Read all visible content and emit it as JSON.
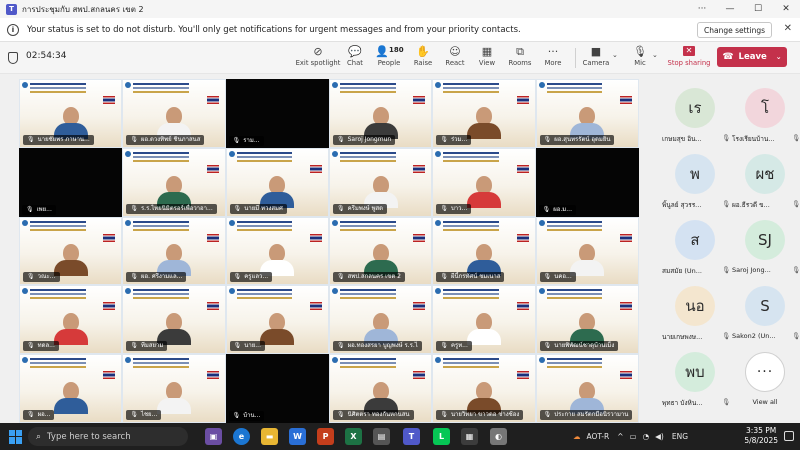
{
  "window": {
    "title": "การประชุมกับ สพป.สกลนคร เขต 2"
  },
  "banner": {
    "message": "Your status is set to do not disturb. You'll only get notifications for urgent messages and from your priority contacts.",
    "change_settings_label": "Change settings"
  },
  "toolbar": {
    "timer": "02:54:34",
    "exit_spotlight": "Exit spotlight",
    "chat": "Chat",
    "people": "People",
    "people_count": "180",
    "raise": "Raise",
    "react": "React",
    "view": "View",
    "rooms": "Rooms",
    "more": "More",
    "camera": "Camera",
    "mic": "Mic",
    "stop_sharing": "Stop sharing",
    "leave": "Leave"
  },
  "tiles": [
    {
      "name": "นายชัยพร ภาษาน..."
    },
    {
      "name": "ผอ.ดวงทิพย์ ชินภาสนส"
    },
    {
      "name": "ราม..."
    },
    {
      "name": "Saroj Jongmun"
    },
    {
      "name": "ร่วม..."
    },
    {
      "name": "ผอ.สุนทรรัตน์ อุดมยิน"
    },
    {
      "name": "เพย..."
    },
    {
      "name": "ร.ร.ไทยนิมิตรอร์เพื่อวาอา..."
    },
    {
      "name": "นายมี ทวงสมศ"
    },
    {
      "name": "ครีมพงษ์ พูสด"
    },
    {
      "name": "บาว..."
    },
    {
      "name": "ผอ.ม..."
    },
    {
      "name": "วณะ..."
    },
    {
      "name": "ผอ. ศรีงามแล..."
    },
    {
      "name": "ครูแลว..."
    },
    {
      "name": "สพป.สกลนคร เขต 2"
    },
    {
      "name": "ผีนี้กรทัศน์ ชมเนาส"
    },
    {
      "name": "นคอ..."
    },
    {
      "name": "ทดล..."
    },
    {
      "name": "ทีมสยาม"
    },
    {
      "name": "นาย..."
    },
    {
      "name": "ผอ.ทองสรยา บูญพงษ์ ร.ร.ไ"
    },
    {
      "name": "ครูท..."
    },
    {
      "name": "นายพิพัฒน์ชาดุบ้านเม็ง"
    },
    {
      "name": "ผอ..."
    },
    {
      "name": "ไชย..."
    },
    {
      "name": "บ้าน..."
    },
    {
      "name": "นิศิตตรา ทองกันหกนสน"
    },
    {
      "name": "นายวิทยา ขาวดอ ช่างช้อง"
    },
    {
      "name": "ประกาย สมรัตกมือนิรวามาน"
    },
    {
      "name": "ไพศ..."
    }
  ],
  "gallery": [
    {
      "initials": "เร",
      "name": "เกษมสุข อิน...",
      "color": "#d9e7d6"
    },
    {
      "initials": "โ",
      "name": "โรงเรียนบ้าน...",
      "color": "#f2d6dc"
    },
    {
      "initials": "พ",
      "name": "พิ้นูลย์ สุวรร...",
      "color": "#d6e4f0"
    },
    {
      "initials": "ผช",
      "name": "ผอ.ธีรวดี ข...",
      "color": "#d5e9e6"
    },
    {
      "initials": "ส",
      "name": "สมสมัย (Un...",
      "color": "#d4e2f2"
    },
    {
      "initials": "SJ",
      "name": "Saroj Jong...",
      "color": "#d4ecdc"
    },
    {
      "initials": "นอ",
      "name": "นายเกษพงษ...",
      "color": "#f4e6cf"
    },
    {
      "initials": "S",
      "name": "Sakon2 (Un...",
      "color": "#d6e4f0"
    },
    {
      "initials": "พบ",
      "name": "พุทธา บังหิน...",
      "color": "#d4ecdc"
    },
    {
      "initials": "···",
      "name": "View all",
      "color": "#ffffff"
    }
  ],
  "taskbar": {
    "search_placeholder": "Type here to search",
    "network": "AOT-R",
    "language": "ENG",
    "time": "3:35 PM",
    "date": "5/8/2025"
  }
}
